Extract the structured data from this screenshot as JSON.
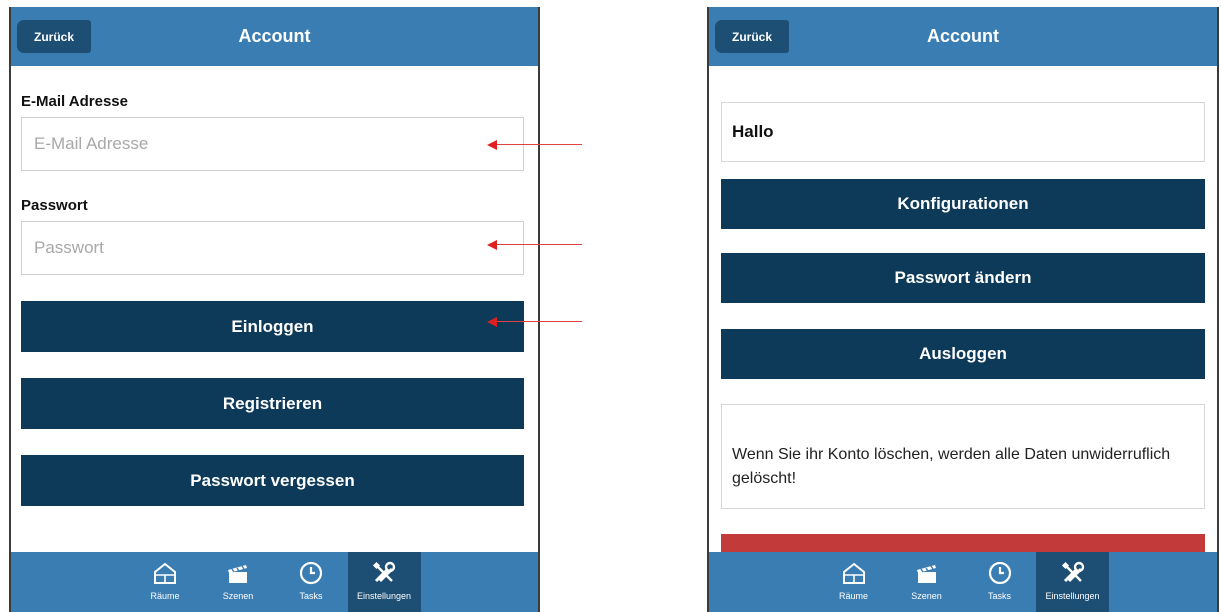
{
  "left_screen": {
    "header": {
      "back_label": "Zurück",
      "title": "Account"
    },
    "email": {
      "label": "E-Mail Adresse",
      "placeholder": "E-Mail Adresse",
      "value": ""
    },
    "password": {
      "label": "Passwort",
      "placeholder": "Passwort",
      "value": ""
    },
    "buttons": {
      "login": "Einloggen",
      "register": "Registrieren",
      "forgot_password": "Passwort vergessen"
    }
  },
  "right_screen": {
    "header": {
      "back_label": "Zurück",
      "title": "Account"
    },
    "greeting": "Hallo",
    "buttons": {
      "configurations": "Konfigurationen",
      "change_password": "Passwort ändern",
      "logout": "Ausloggen"
    },
    "delete_warning": "Wenn Sie ihr Konto löschen, werden alle Daten unwiderruflich gelöscht!"
  },
  "tabbar": {
    "tabs": [
      {
        "label": "Räume",
        "icon": "house-icon",
        "active": false
      },
      {
        "label": "Szenen",
        "icon": "clapperboard-icon",
        "active": false
      },
      {
        "label": "Tasks",
        "icon": "clock-icon",
        "active": false
      },
      {
        "label": "Einstellungen",
        "icon": "tools-icon",
        "active": true
      }
    ]
  },
  "colors": {
    "header_blue": "#3a7db3",
    "button_navy": "#0e3a5a",
    "active_tab": "#1d4e74",
    "delete_red": "#c23a3a",
    "annotation_arrow": "#e02020"
  }
}
